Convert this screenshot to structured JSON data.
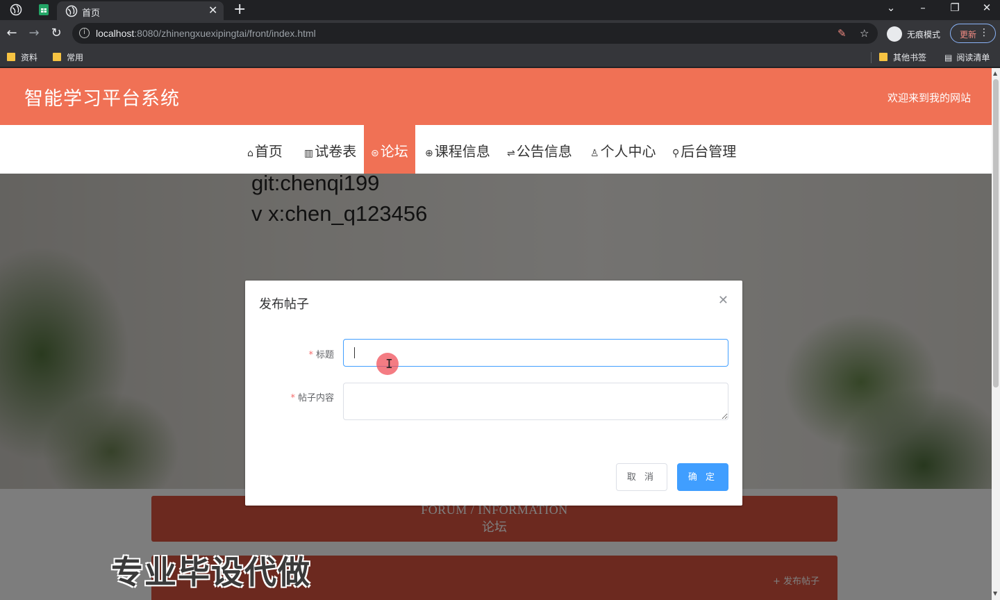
{
  "browser": {
    "tab_title": "首页",
    "url_host": "localhost",
    "url_rest": ":8080/zhinengxuexipingtai/front/index.html",
    "incognito_label": "无痕模式",
    "update_label": "更新",
    "bookmarks": [
      "资料",
      "常用"
    ],
    "bookmarks_right": [
      "其他书签",
      "阅读清单"
    ],
    "icons": [
      "globe-icon",
      "sheets-icon",
      "back-icon",
      "forward-icon",
      "reload-icon",
      "info-icon",
      "star-icon",
      "incognito-icon",
      "reading-list-icon"
    ]
  },
  "site": {
    "title": "智能学习平台系统",
    "welcome": "欢迎来到我的网站",
    "menu": [
      {
        "icon": "⌂",
        "label": "首页"
      },
      {
        "icon": "▥",
        "label": "试卷表"
      },
      {
        "icon": "⊜",
        "label": "论坛"
      },
      {
        "icon": "⊕",
        "label": "课程信息"
      },
      {
        "icon": "⇌",
        "label": "公告信息"
      },
      {
        "icon": "♙",
        "label": "个人中心"
      },
      {
        "icon": "⚲",
        "label": "后台管理"
      }
    ],
    "active_menu": "论坛",
    "banner_lines": [
      "git:chenqi199",
      "v x:chen_q123456"
    ],
    "forum_en": "FORUM / INFORMATION",
    "forum_cn": "论坛",
    "post_link": "+  发布帖子",
    "watermark": "专业毕设代做",
    "accent_color": "#f07155"
  },
  "dialog": {
    "title": "发布帖子",
    "fields": [
      {
        "label": "标题",
        "required": true,
        "value": "",
        "type": "input"
      },
      {
        "label": "帖子内容",
        "required": true,
        "value": "",
        "type": "textarea"
      }
    ],
    "cancel_label": "取 消",
    "ok_label": "确 定",
    "primary_color": "#409eff"
  }
}
